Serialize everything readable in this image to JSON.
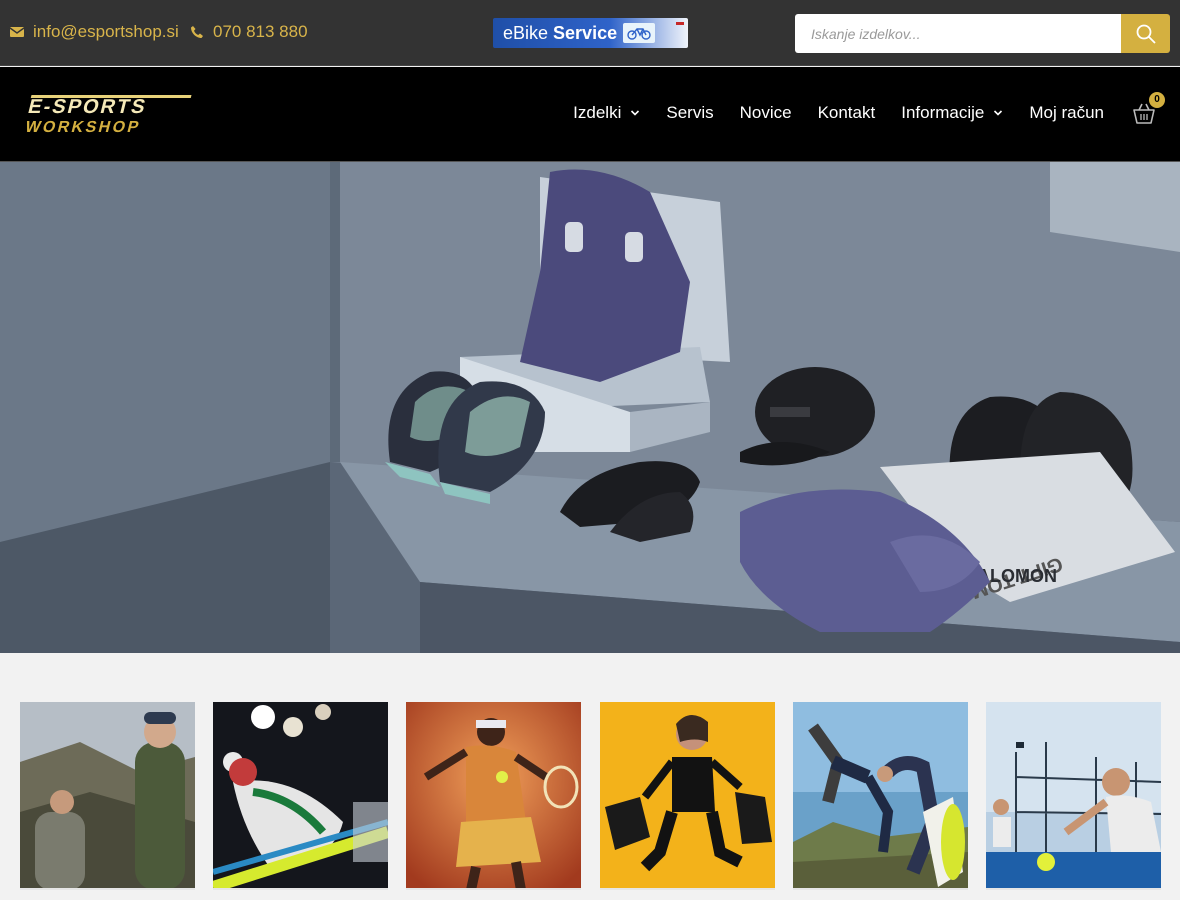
{
  "header": {
    "email": "info@esportshop.si",
    "phone": "070 813 880",
    "ebike_banner": {
      "text_prefix": "eBike",
      "text_bold": "Service"
    },
    "search": {
      "placeholder": "Iskanje izdelkov..."
    }
  },
  "nav": {
    "logo_line1": "E-SPORTS",
    "logo_line2": "WORKSHOP",
    "items": [
      {
        "label": "Izdelki",
        "has_dropdown": true
      },
      {
        "label": "Servis",
        "has_dropdown": false
      },
      {
        "label": "Novice",
        "has_dropdown": false
      },
      {
        "label": "Kontakt",
        "has_dropdown": false
      },
      {
        "label": "Informacije",
        "has_dropdown": true
      },
      {
        "label": "Moj račun",
        "has_dropdown": false
      }
    ],
    "cart_count": "0"
  },
  "hero": {
    "brand_on_products": "SALOMON",
    "gift_box_text": "GIFT TOM"
  },
  "categories": [
    {
      "id": "hiking"
    },
    {
      "id": "ski"
    },
    {
      "id": "tennis"
    },
    {
      "id": "shopping"
    },
    {
      "id": "trail-running"
    },
    {
      "id": "padel"
    }
  ],
  "colors": {
    "accent": "#d4b040",
    "topbar": "#333333",
    "navbar": "#000000",
    "page_bg": "#f2f2f2"
  },
  "icons": [
    "envelope-icon",
    "phone-icon",
    "bike-icon",
    "search-icon",
    "chevron-down-icon",
    "cart-icon"
  ]
}
